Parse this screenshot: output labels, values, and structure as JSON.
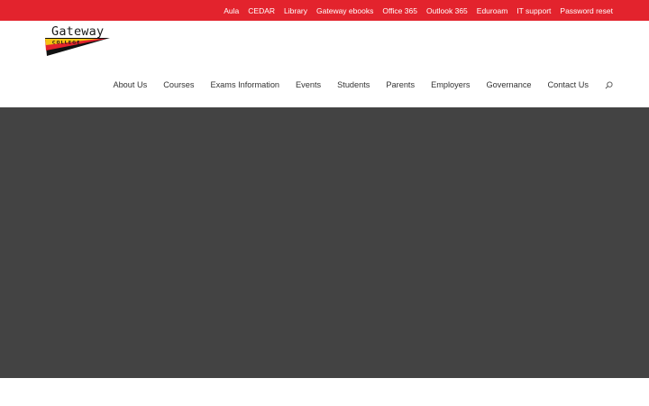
{
  "topbar": {
    "links": [
      "Aula",
      "CEDAR",
      "Library",
      "Gateway ebooks",
      "Office 365",
      "Outlook 365",
      "Eduroam",
      "IT support",
      "Password reset"
    ],
    "background": "#e3232d"
  },
  "logo": {
    "word": "Gateway",
    "subword": "COLLEGE",
    "colors": {
      "yellow": "#f6c312",
      "red": "#e3232d",
      "black": "#111111"
    }
  },
  "nav": {
    "items": [
      "About Us",
      "Courses",
      "Exams Information",
      "Events",
      "Students",
      "Parents",
      "Employers",
      "Governance",
      "Contact Us"
    ],
    "search_icon": "search-icon"
  },
  "hero": {
    "background": "#434343"
  }
}
